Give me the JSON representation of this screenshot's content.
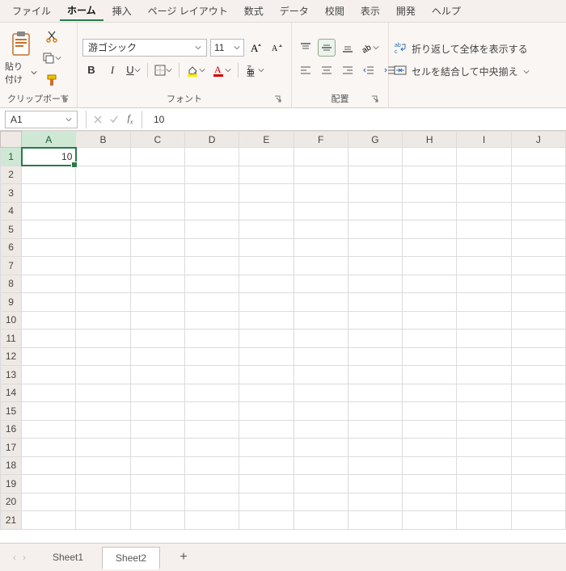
{
  "menu": {
    "items": [
      "ファイル",
      "ホーム",
      "挿入",
      "ページ レイアウト",
      "数式",
      "データ",
      "校閲",
      "表示",
      "開発",
      "ヘルプ"
    ],
    "active_index": 1
  },
  "ribbon": {
    "clipboard": {
      "paste": "貼り付け",
      "label": "クリップボード"
    },
    "font": {
      "name": "游ゴシック",
      "size": "11",
      "label": "フォント"
    },
    "alignment": {
      "label": "配置"
    },
    "wrap_text": "折り返して全体を表示する",
    "merge_center": "セルを結合して中央揃え"
  },
  "formula": {
    "namebox": "A1",
    "value": "10"
  },
  "grid": {
    "columns": [
      "A",
      "B",
      "C",
      "D",
      "E",
      "F",
      "G",
      "H",
      "I",
      "J"
    ],
    "rows": 21,
    "active_col": "A",
    "active_row": 1,
    "cells": {
      "A1": "10"
    }
  },
  "sheets": {
    "tabs": [
      "Sheet1",
      "Sheet2"
    ],
    "active_index": 1
  }
}
